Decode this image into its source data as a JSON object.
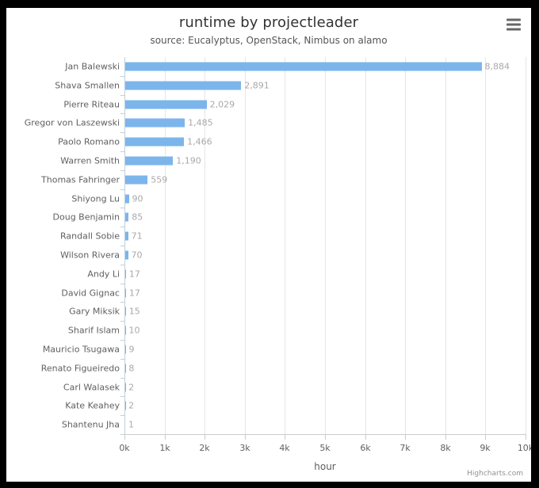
{
  "chart_data": {
    "type": "bar",
    "title": "runtime by projectleader",
    "subtitle": "source: Eucalyptus, OpenStack, Nimbus on alamo",
    "xlabel": "hour",
    "ylabel": "",
    "orientation": "horizontal",
    "grid": true,
    "legend": false,
    "xlim": [
      0,
      10000
    ],
    "x_tick_labels": [
      "0k",
      "1k",
      "2k",
      "3k",
      "4k",
      "5k",
      "6k",
      "7k",
      "8k",
      "9k",
      "10k"
    ],
    "x_tick_values": [
      0,
      1000,
      2000,
      3000,
      4000,
      5000,
      6000,
      7000,
      8000,
      9000,
      10000
    ],
    "series_color": "#7cb5ec",
    "categories": [
      "Jan Balewski",
      "Shava Smallen",
      "Pierre Riteau",
      "Gregor von Laszewski",
      "Paolo Romano",
      "Warren Smith",
      "Thomas Fahringer",
      "Shiyong Lu",
      "Doug Benjamin",
      "Randall Sobie",
      "Wilson Rivera",
      "Andy Li",
      "David Gignac",
      "Gary Miksik",
      "Sharif Islam",
      "Mauricio Tsugawa",
      "Renato Figueiredo",
      "Carl Walasek",
      "Kate Keahey",
      "Shantenu Jha"
    ],
    "values": [
      8884,
      2891,
      2029,
      1485,
      1466,
      1190,
      559,
      90,
      85,
      71,
      70,
      17,
      17,
      15,
      10,
      9,
      8,
      2,
      2,
      1
    ],
    "data_labels": [
      "8,884",
      "2,891",
      "2,029",
      "1,485",
      "1,466",
      "1,190",
      "559",
      "90",
      "85",
      "71",
      "70",
      "17",
      "17",
      "15",
      "10",
      "9",
      "8",
      "2",
      "2",
      "1"
    ]
  },
  "context_menu": {
    "icon": "hamburger-menu-icon"
  },
  "credits": {
    "text": "Highcharts.com"
  }
}
